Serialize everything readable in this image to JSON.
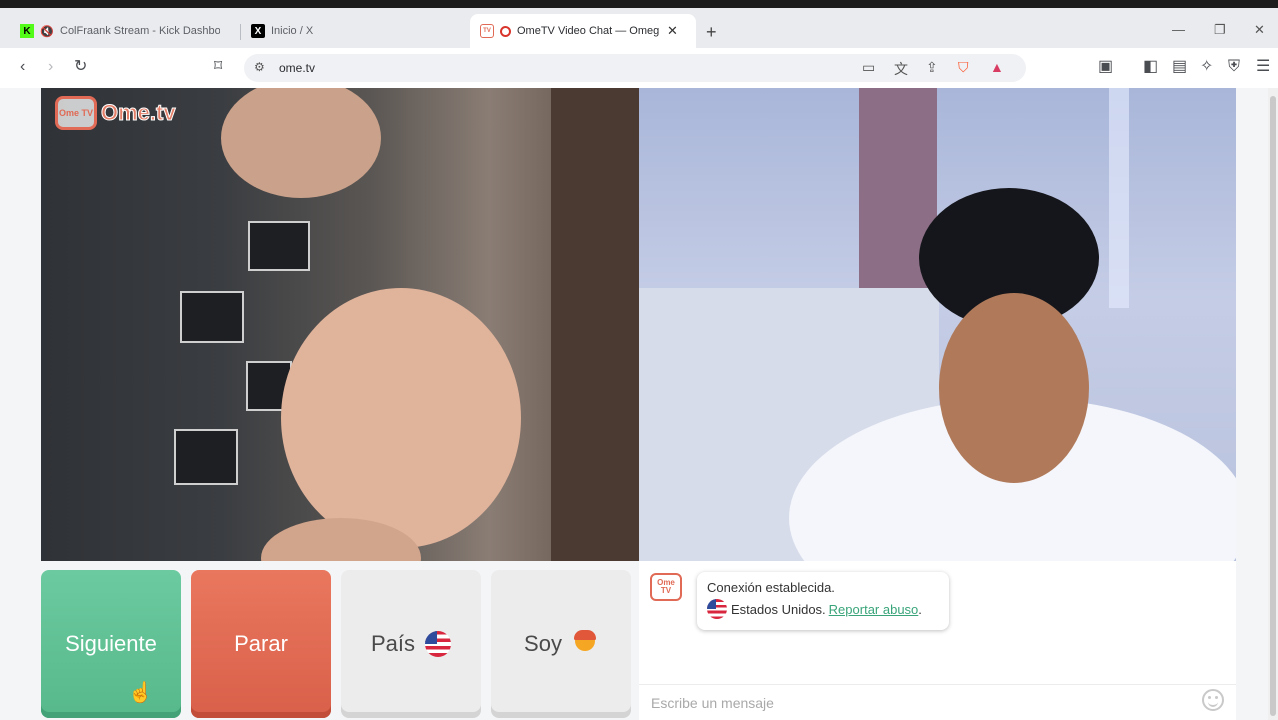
{
  "browser": {
    "tabs": [
      {
        "label": "ColFraank Stream - Kick Dashboa",
        "favicon": "kick-icon"
      },
      {
        "label": "Inicio / X",
        "favicon": "x-icon"
      },
      {
        "label": "OmeTV Video Chat — Omegl",
        "favicon": "ometv-icon",
        "active": true
      }
    ],
    "new_tab_label": "+",
    "url": "ome.tv"
  },
  "site": {
    "logo_badge": "Ome TV",
    "logo_text": "Ome.tv"
  },
  "controls": {
    "next_label": "Siguiente",
    "stop_label": "Parar",
    "country_label": "País",
    "gender_label": "Soy"
  },
  "chat": {
    "avatar_label": "Ome TV",
    "status": "Conexión establecida.",
    "country": "Estados Unidos.",
    "report_label": "Reportar abuso",
    "report_suffix": ".",
    "input_placeholder": "Escribe un mensaje"
  },
  "colors": {
    "next_button": "#5fc094",
    "stop_button": "#e0674f",
    "brand": "#e06a55",
    "link": "#39a47a"
  }
}
